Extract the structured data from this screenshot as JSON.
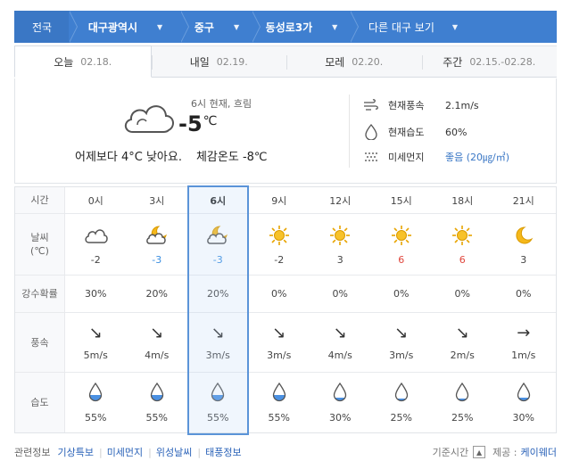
{
  "breadcrumb": {
    "country": "전국",
    "city": "대구광역시",
    "district": "중구",
    "town": "동성로3가",
    "other": "다른 대구 보기"
  },
  "tabs": [
    {
      "label": "오늘",
      "date": "02.18."
    },
    {
      "label": "내일",
      "date": "02.19."
    },
    {
      "label": "모레",
      "date": "02.20."
    },
    {
      "label": "주간",
      "date": "02.15.-02.28."
    }
  ],
  "current": {
    "meta": "6시 현재, 흐림",
    "temp": "-5",
    "unit": "℃",
    "compare": "어제보다 4°C 낮아요.",
    "feels": "체감온도 -8℃",
    "icon": "cloudy-icon",
    "wind_label": "현재풍속",
    "wind_value": "2.1m/s",
    "humidity_label": "현재습도",
    "humidity_value": "60%",
    "dust_label": "미세먼지",
    "dust_value": "좋음 (20㎍/㎥)"
  },
  "table": {
    "time_label": "시간",
    "weather_label": "날씨\n(℃)",
    "rain_label": "강수확률",
    "wind_label": "풍속",
    "humidity_label": "습도",
    "hours": [
      {
        "time": "0시",
        "icon": "cloudy-icon",
        "temp": "-2",
        "rain": "30%",
        "wind": "5m/s",
        "wind_dir": "↘",
        "humidity": "55%",
        "humidity_frac": 0.55,
        "temp_color": "normal"
      },
      {
        "time": "3시",
        "icon": "partly-cloudy-night-icon",
        "temp": "-3",
        "rain": "20%",
        "wind": "4m/s",
        "wind_dir": "↘",
        "humidity": "55%",
        "humidity_frac": 0.55,
        "temp_color": "cold"
      },
      {
        "time": "6시",
        "icon": "partly-cloudy-night-icon",
        "temp": "-3",
        "rain": "20%",
        "wind": "3m/s",
        "wind_dir": "↘",
        "humidity": "55%",
        "humidity_frac": 0.55,
        "temp_color": "cold"
      },
      {
        "time": "9시",
        "icon": "sun-icon",
        "temp": "-2",
        "rain": "0%",
        "wind": "3m/s",
        "wind_dir": "↘",
        "humidity": "55%",
        "humidity_frac": 0.55,
        "temp_color": "normal"
      },
      {
        "time": "12시",
        "icon": "sun-icon",
        "temp": "3",
        "rain": "0%",
        "wind": "4m/s",
        "wind_dir": "↘",
        "humidity": "30%",
        "humidity_frac": 0.3,
        "temp_color": "normal"
      },
      {
        "time": "15시",
        "icon": "sun-icon",
        "temp": "6",
        "rain": "0%",
        "wind": "3m/s",
        "wind_dir": "↘",
        "humidity": "25%",
        "humidity_frac": 0.25,
        "temp_color": "hot"
      },
      {
        "time": "18시",
        "icon": "sun-icon",
        "temp": "6",
        "rain": "0%",
        "wind": "2m/s",
        "wind_dir": "↘",
        "humidity": "25%",
        "humidity_frac": 0.25,
        "temp_color": "hot"
      },
      {
        "time": "21시",
        "icon": "moon-icon",
        "temp": "3",
        "rain": "0%",
        "wind": "1m/s",
        "wind_dir": "→",
        "humidity": "30%",
        "humidity_frac": 0.3,
        "temp_color": "normal"
      }
    ]
  },
  "footer": {
    "label": "관련정보",
    "links": [
      "기상특보",
      "미세먼지",
      "위성날씨",
      "태풍정보"
    ],
    "base_time": "기준시간",
    "provider_label": "제공 :",
    "provider": "케이웨더"
  },
  "colors": {
    "accent": "#3f7fd0",
    "cold": "#3a8ee0",
    "hot": "#e0463c",
    "highlight": "#5b94d8"
  }
}
